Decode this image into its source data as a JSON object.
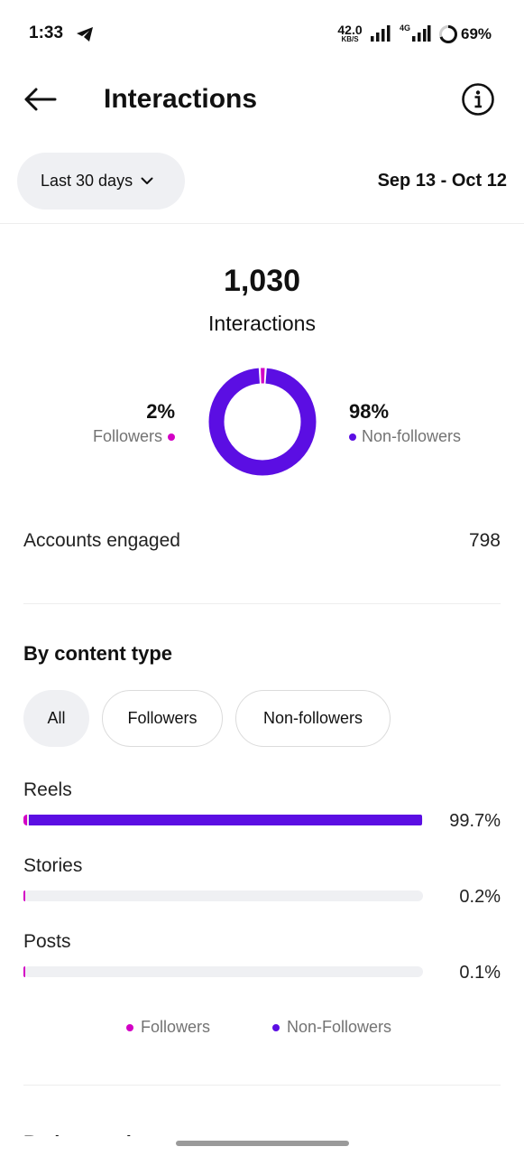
{
  "status_bar": {
    "time": "1:33",
    "net_speed": "42.0",
    "net_unit": "KB/S",
    "network_type": "4G",
    "battery": "69%"
  },
  "header": {
    "title": "Interactions",
    "back_icon": "arrow-left-icon",
    "info_icon": "info-icon"
  },
  "date_filter": {
    "range_label": "Last 30 days",
    "date_range": "Sep 13 - Oct 12"
  },
  "summary": {
    "total": "1,030",
    "total_label": "Interactions",
    "followers_pct": "2%",
    "followers_label": "Followers",
    "nonfollowers_pct": "98%",
    "nonfollowers_label": "Non-followers",
    "followers_share": 0.02,
    "nonfollowers_share": 0.98
  },
  "accounts_engaged": {
    "label": "Accounts engaged",
    "value": "798"
  },
  "content_type": {
    "title": "By content type",
    "filters": [
      "All",
      "Followers",
      "Non-followers"
    ],
    "selected_filter": "All",
    "rows": [
      {
        "label": "Reels",
        "pct": "99.7%",
        "value": 0.997,
        "followers_share": 0.01
      },
      {
        "label": "Stories",
        "pct": "0.2%",
        "value": 0.002,
        "followers_share": 1.0
      },
      {
        "label": "Posts",
        "pct": "0.1%",
        "value": 0.001,
        "followers_share": 1.0
      }
    ],
    "legend": [
      "Followers",
      "Non-Followers"
    ]
  },
  "colors": {
    "followers": "#d300c5",
    "nonfollowers": "#5b0ee3",
    "track": "#eff0f3",
    "chip_selected": "#eff0f3"
  },
  "next_section_title": "By interaction"
}
